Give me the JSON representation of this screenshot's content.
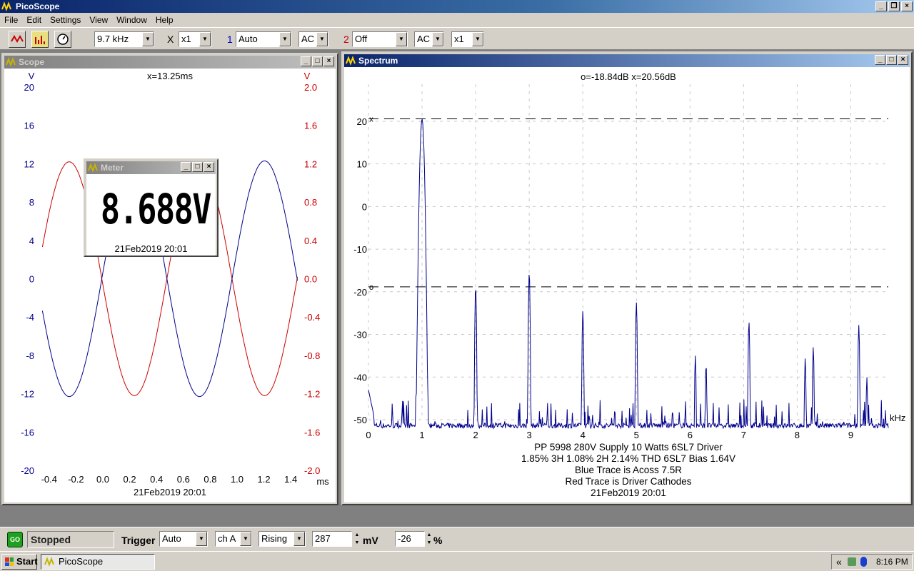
{
  "window": {
    "title": "PicoScope"
  },
  "menu": [
    "File",
    "Edit",
    "Settings",
    "View",
    "Window",
    "Help"
  ],
  "toolbar": {
    "timebase": "9.7 kHz",
    "x_label": "X",
    "x_mult": "x1",
    "ch1_num": "1",
    "ch1_range": "Auto",
    "ch1_coupling": "AC",
    "ch2_num": "2",
    "ch2_range": "Off",
    "ch2_coupling": "AC",
    "ch2_mult": "x1"
  },
  "scope": {
    "title": "Scope",
    "cursor": "x=13.25ms",
    "left_unit": "V",
    "right_unit": "V",
    "x_unit": "ms",
    "left_ticks": [
      "20",
      "16",
      "12",
      "8",
      "4",
      "0",
      "-4",
      "-8",
      "-12",
      "-16",
      "-20"
    ],
    "right_ticks": [
      "2.0",
      "1.6",
      "1.2",
      "0.8",
      "0.4",
      "0.0",
      "-0.4",
      "-0.8",
      "-1.2",
      "-1.6",
      "-2.0"
    ],
    "x_ticks": [
      "-0.4",
      "-0.2",
      "0.0",
      "0.2",
      "0.4",
      "0.6",
      "0.8",
      "1.0",
      "1.2",
      "1.4"
    ],
    "date": "21Feb2019  20:01",
    "colors": {
      "blue": "#00008b",
      "red": "#cc0000"
    }
  },
  "meter": {
    "title": "Meter",
    "value": "8.688V",
    "date": "21Feb2019  20:01"
  },
  "spectrum": {
    "title": "Spectrum",
    "cursor": "o=-18.84dB  x=20.56dB",
    "y_ticks": [
      "20",
      "10",
      "0",
      "-10",
      "-20",
      "-30",
      "-40",
      "-50"
    ],
    "x_ticks": [
      "0",
      "1",
      "2",
      "3",
      "4",
      "5",
      "6",
      "7",
      "8",
      "9"
    ],
    "x_unit": "kHz",
    "notes": [
      "PP 5998 280V Supply 10 Watts 6SL7 Driver",
      "1.85% 3H 1.08% 2H 2.14% THD 6SL7 Bias 1.64V",
      "Blue Trace is Acoss 7.5R",
      "Red Trace is Driver Cathodes",
      "21Feb2019  20:01"
    ],
    "marker_x": "x",
    "marker_o": "o"
  },
  "chart_data": [
    {
      "type": "line",
      "title": "",
      "xlabel": "ms",
      "ylabel": "V",
      "xlim": [
        -0.5,
        1.5
      ],
      "ylim": [
        -20,
        20
      ],
      "y2lim": [
        -2.0,
        2.0
      ],
      "grid": false,
      "series": [
        {
          "axis": "left",
          "period_ms": 0.97,
          "amplitude": 12.3,
          "x_of_negative_peak_ms": -0.25
        },
        {
          "axis": "right",
          "period_ms": 0.97,
          "amplitude": 1.22,
          "x_of_positive_peak_ms": -0.25
        }
      ]
    },
    {
      "type": "line",
      "xlabel": "kHz",
      "ylabel": "dB",
      "xlim": [
        0,
        9.7
      ],
      "ylim": [
        -50,
        25
      ],
      "grid": true,
      "cursors": [
        20.56,
        -18.84
      ],
      "peaks": [
        {
          "x": 1.0,
          "y": 20.5
        },
        {
          "x": 2.0,
          "y": -18.8
        },
        {
          "x": 3.0,
          "y": -15.5
        },
        {
          "x": 4.0,
          "y": -24.5
        },
        {
          "x": 5.0,
          "y": -22.5
        },
        {
          "x": 6.1,
          "y": -35.0
        },
        {
          "x": 6.3,
          "y": -37.0
        },
        {
          "x": 7.1,
          "y": -27.0
        },
        {
          "x": 8.15,
          "y": -35.5
        },
        {
          "x": 8.3,
          "y": -33.0
        },
        {
          "x": 9.15,
          "y": -27.8
        },
        {
          "x": 9.3,
          "y": -40.0
        }
      ]
    }
  ],
  "status": {
    "go_label": "GO",
    "state": "Stopped",
    "trigger_label": "Trigger",
    "trigger_mode": "Auto",
    "trigger_channel": "ch A",
    "trigger_edge": "Rising",
    "trigger_level": "287",
    "level_unit": "mV",
    "pretrigger": "-26",
    "pretrigger_unit": "%"
  },
  "taskbar": {
    "start": "Start",
    "task": "PicoScope",
    "tray_arrows": "«",
    "time": "8:16 PM"
  }
}
